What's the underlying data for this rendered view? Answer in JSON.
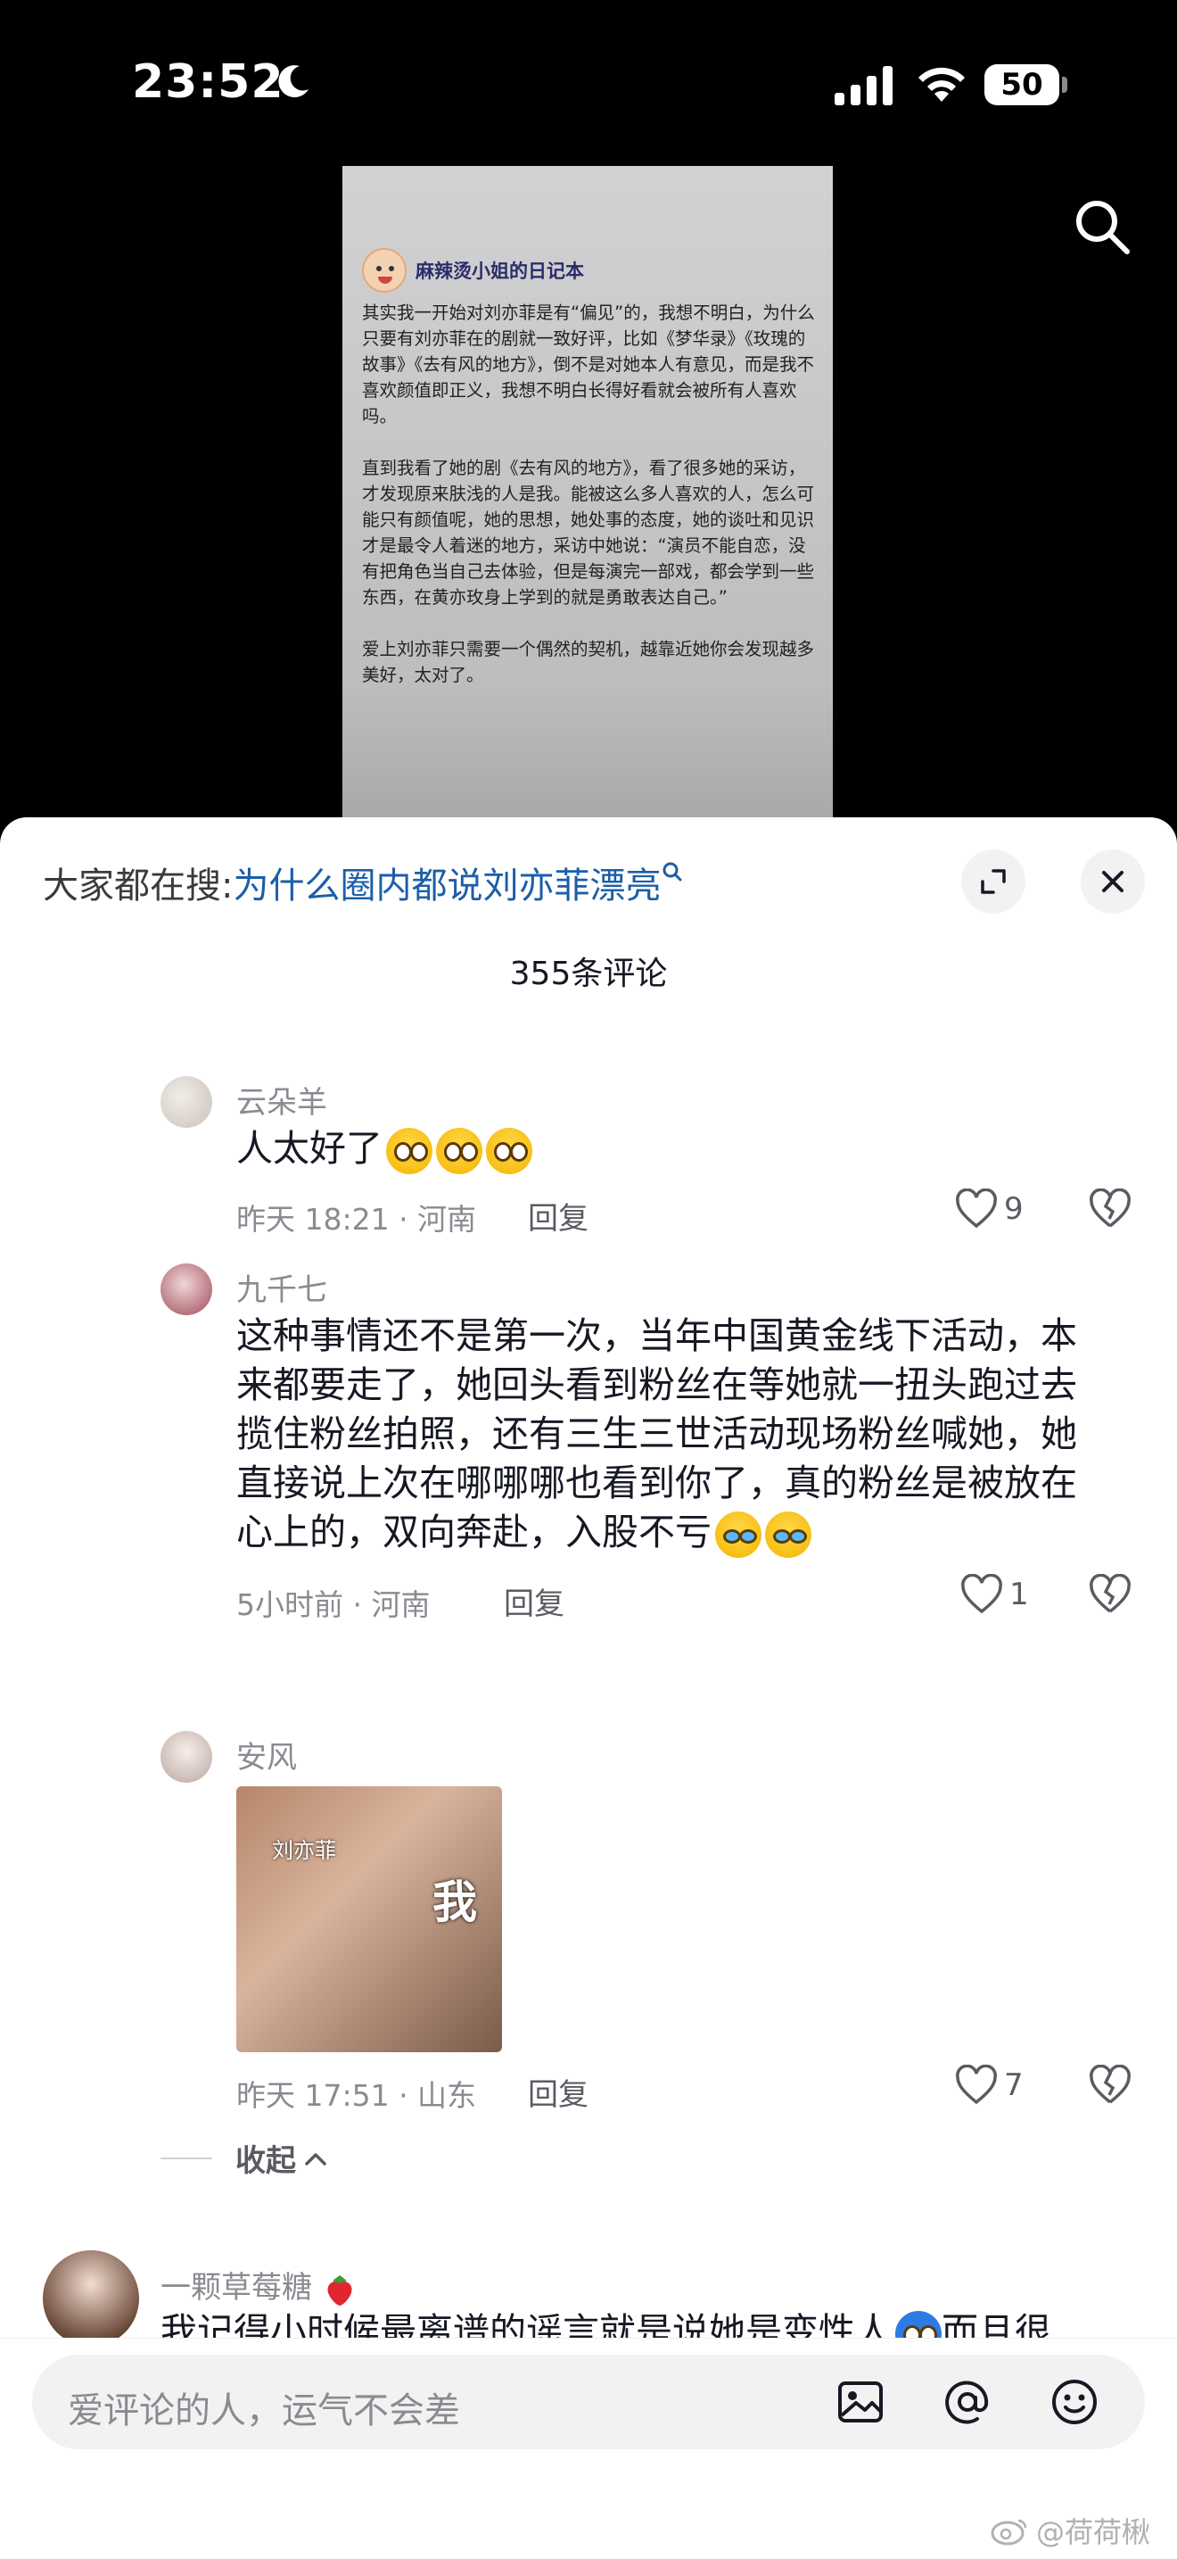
{
  "status_bar": {
    "time": "23:52",
    "battery": "50"
  },
  "video": {
    "diary_title": "麻辣烫小姐的日记本",
    "paragraphs": [
      "其实我一开始对刘亦菲是有“偏见”的，我想不明白，为什么只要有刘亦菲在的剧就一致好评，比如《梦华录》《玫瑰的故事》《去有风的地方》，倒不是对她本人有意见，而是我不喜欢颜值即正义，我想不明白长得好看就会被所有人喜欢吗。",
      "直到我看了她的剧《去有风的地方》，看了很多她的采访，才发现原来肤浅的人是我。能被这么多人喜欢的人，怎么可能只有颜值呢，她的思想，她处事的态度，她的谈吐和见识才是最令人着迷的地方，采访中她说：“演员不能自恋，没有把角色当自己去体验，但是每演完一部戏，都会学到一些东西，在黄亦玫身上学到的就是勇敢表达自己。”",
      "爱上刘亦菲只需要一个偶然的契机，越靠近她你会发现越多美好，太对了。"
    ]
  },
  "sheet": {
    "suggest_prefix": "大家都在搜:",
    "suggest_link": "为什么圈内都说刘亦菲漂亮",
    "comment_count": "355条评论"
  },
  "replies": [
    {
      "username": "云朵羊",
      "content": "人太好了",
      "time_location": "昨天 18:21 · 河南",
      "reply_label": "回复",
      "likes": "9"
    },
    {
      "username": "九千七",
      "content": "这种事情还不是第一次，当年中国黄金线下活动，本来都要走了，她回头看到粉丝在等她就一扭头跑过去揽住粉丝拍照，还有三生三世活动现场粉丝喊她，她直接说上次在哪哪哪也看到你了，真的粉丝是被放在心上的，双向奔赴，入股不亏",
      "time_location": "5小时前 · 河南",
      "reply_label": "回复",
      "likes": "1"
    },
    {
      "username": "安风",
      "sticker_label_a": "刘亦菲",
      "sticker_label_b": "我",
      "time_location": "昨天 17:51 · 山东",
      "reply_label": "回复",
      "likes": "7"
    }
  ],
  "collapse_label": "收起",
  "top_comment": {
    "username": "一颗草莓糖",
    "content_partial": "我记得小时候最离谱的谣言就是说她是变性人",
    "content_tail": "而且很"
  },
  "input": {
    "placeholder": "爱评论的人，运气不会差"
  },
  "watermark": "@荷荷楸"
}
